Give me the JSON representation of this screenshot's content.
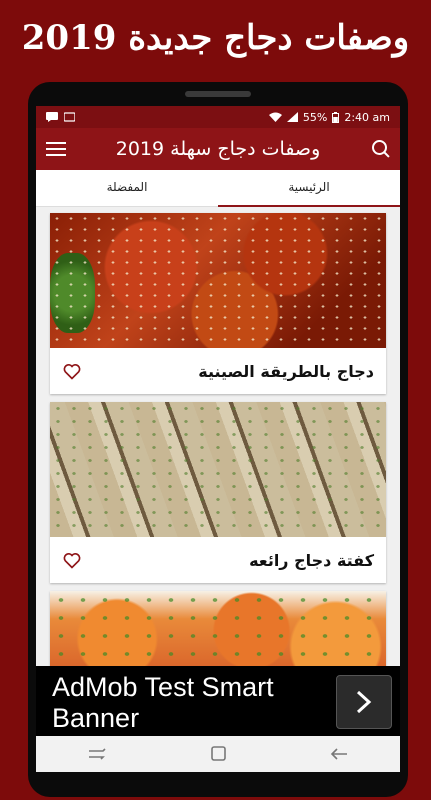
{
  "promo": {
    "title": "وصفات دجاج جديدة 2019"
  },
  "status": {
    "battery": "55%",
    "time": "2:40 am"
  },
  "appbar": {
    "title": "وصفات دجاج سهلة 2019",
    "menu_icon": "hamburger-menu-icon",
    "search_icon": "search-icon"
  },
  "tabs": [
    {
      "label": "المفضلة",
      "active": false
    },
    {
      "label": "الرئيسية",
      "active": true
    }
  ],
  "recipes": [
    {
      "title": "دجاج بالطريقة الصينية",
      "icon": "heart-outline-icon"
    },
    {
      "title": "كفتة دجاج رائعه",
      "icon": "heart-outline-icon"
    }
  ],
  "ad": {
    "text": "AdMob Test Smart Banner",
    "button_icon": "chevron-right-icon"
  },
  "colors": {
    "brand": "#8e1417",
    "background": "#7d0b0b",
    "status_bar": "#7c0f12"
  }
}
